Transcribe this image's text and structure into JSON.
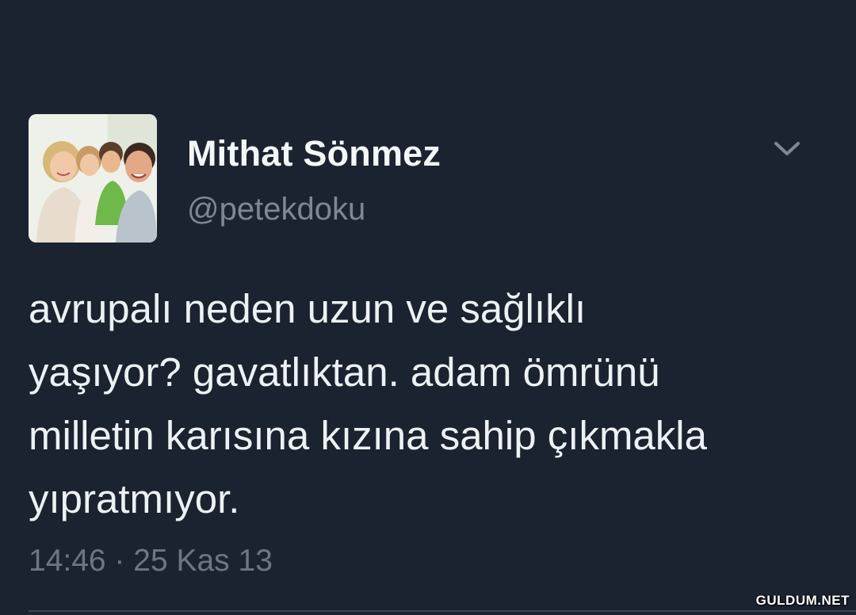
{
  "user": {
    "display_name": "Mithat Sönmez",
    "handle": "@petekdoku",
    "avatar_icon": "family-photo-avatar"
  },
  "menu": {
    "icon": "chevron-down-icon"
  },
  "tweet": {
    "lines": [
      "avrupalı neden uzun ve sağlıklı",
      "yaşıyor? gavatlıktan. adam ömrünü",
      "milletin karısına kızına sahip çıkmakla",
      "yıpratmıyor."
    ]
  },
  "meta": {
    "timestamp": "14:46 · 25 Kas 13"
  },
  "watermark": {
    "text": "GULDUM.NET"
  },
  "colors": {
    "background": "#1b2330",
    "name": "#f4f6f8",
    "handle": "#7e8894",
    "body_text": "#eef1f4",
    "meta": "#6c7784"
  }
}
